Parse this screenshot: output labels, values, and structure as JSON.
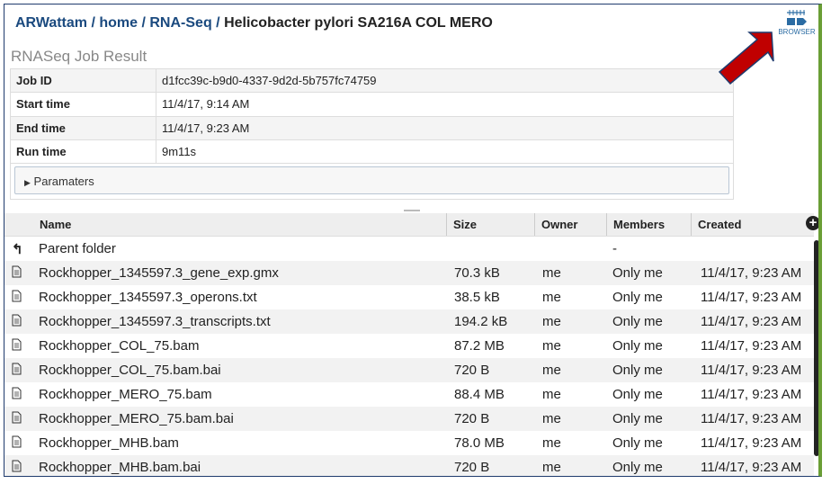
{
  "breadcrumb": {
    "user": "ARWattam",
    "home": "home",
    "folder": "RNA-Seq",
    "sep": " / ",
    "current": "Helicobacter pylori SA216A COL MERO"
  },
  "subtitle": "RNASeq Job Result",
  "job": [
    {
      "k": "Job ID",
      "v": "d1fcc39c-b9d0-4337-9d2d-5b757fc74759"
    },
    {
      "k": "Start time",
      "v": "11/4/17, 9:14 AM"
    },
    {
      "k": "End time",
      "v": "11/4/17, 9:23 AM"
    },
    {
      "k": "Run time",
      "v": "9m11s"
    }
  ],
  "params_label": "Paramaters",
  "browser_label": "BROWSER",
  "columns": [
    "Name",
    "Size",
    "Owner",
    "Members",
    "Created"
  ],
  "parent": {
    "name": "Parent folder",
    "members": "-"
  },
  "files": [
    {
      "name": "Rockhopper_1345597.3_gene_exp.gmx",
      "size": "70.3 kB",
      "owner": "me",
      "members": "Only me",
      "created": "11/4/17, 9:23 AM"
    },
    {
      "name": "Rockhopper_1345597.3_operons.txt",
      "size": "38.5 kB",
      "owner": "me",
      "members": "Only me",
      "created": "11/4/17, 9:23 AM"
    },
    {
      "name": "Rockhopper_1345597.3_transcripts.txt",
      "size": "194.2 kB",
      "owner": "me",
      "members": "Only me",
      "created": "11/4/17, 9:23 AM"
    },
    {
      "name": "Rockhopper_COL_75.bam",
      "size": "87.2 MB",
      "owner": "me",
      "members": "Only me",
      "created": "11/4/17, 9:23 AM"
    },
    {
      "name": "Rockhopper_COL_75.bam.bai",
      "size": "720 B",
      "owner": "me",
      "members": "Only me",
      "created": "11/4/17, 9:23 AM"
    },
    {
      "name": "Rockhopper_MERO_75.bam",
      "size": "88.4 MB",
      "owner": "me",
      "members": "Only me",
      "created": "11/4/17, 9:23 AM"
    },
    {
      "name": "Rockhopper_MERO_75.bam.bai",
      "size": "720 B",
      "owner": "me",
      "members": "Only me",
      "created": "11/4/17, 9:23 AM"
    },
    {
      "name": "Rockhopper_MHB.bam",
      "size": "78.0 MB",
      "owner": "me",
      "members": "Only me",
      "created": "11/4/17, 9:23 AM"
    },
    {
      "name": "Rockhopper_MHB.bam.bai",
      "size": "720 B",
      "owner": "me",
      "members": "Only me",
      "created": "11/4/17, 9:23 AM"
    }
  ]
}
